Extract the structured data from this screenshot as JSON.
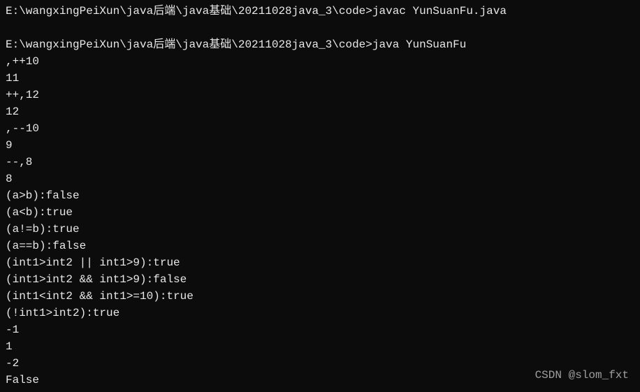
{
  "prompt1": {
    "path": "E:\\wangxingPeiXun\\java后端\\java基础\\20211028java_3\\code>",
    "command": "javac YunSuanFu.java"
  },
  "prompt2": {
    "path": "E:\\wangxingPeiXun\\java后端\\java基础\\20211028java_3\\code>",
    "command": "java YunSuanFu"
  },
  "output": [
    ",++10",
    "11",
    "++,12",
    "12",
    ",--10",
    "9",
    "--,8",
    "8",
    "(a>b):false",
    "(a<b):true",
    "(a!=b):true",
    "(a==b):false",
    "(int1>int2 || int1>9):true",
    "(int1>int2 && int1>9):false",
    "(int1<int2 && int1>=10):true",
    "(!int1>int2):true",
    "-1",
    "1",
    "-2",
    "False"
  ],
  "watermark": "CSDN @slom_fxt"
}
